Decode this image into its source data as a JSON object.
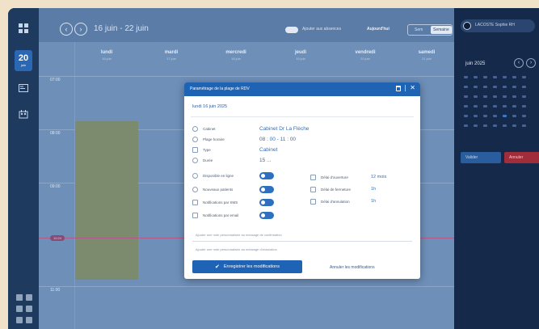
{
  "calendar": {
    "range": "16 juin - 22 juin",
    "toggle_label": "Ajouter aux absences",
    "today_label": "Aujourd'hui",
    "view_week": "Sem",
    "view_active": "Semaine",
    "days": [
      {
        "name": "lundi",
        "date": "16 juin"
      },
      {
        "name": "mardi",
        "date": "17 juin"
      },
      {
        "name": "mercredi",
        "date": "18 juin"
      },
      {
        "name": "jeudi",
        "date": "19 juin"
      },
      {
        "name": "vendredi",
        "date": "20 juin"
      },
      {
        "name": "samedi",
        "date": "21 juin"
      }
    ],
    "times": [
      "07:00",
      "08:00",
      "09:00",
      "11:00"
    ],
    "now": "10:24"
  },
  "rail": {
    "today_num": "20",
    "today_sub": "juin"
  },
  "right_panel": {
    "user_name": "LACOSTE Sophie RH",
    "month_title": "juin 2025",
    "validate_label": "Valider",
    "delete_label": "Annuler"
  },
  "modal": {
    "title": "Paramétrage de la plage de RDV",
    "date": "lundi 16 juin 2025",
    "rows": [
      {
        "label": "Cabinet",
        "value": "Cabinet Dr La Flèche"
      },
      {
        "label": "Plage horaire",
        "value": "08 : 00  -  11 : 00"
      },
      {
        "label": "Type",
        "value": "Cabinet"
      },
      {
        "label": "Durée",
        "value": "15 ..."
      }
    ],
    "toggles": [
      {
        "label": "Disponible en ligne"
      },
      {
        "label": "Nouveaux patients"
      },
      {
        "label": "Notifications par SMS"
      },
      {
        "label": "Notifications par email"
      }
    ],
    "delays": [
      {
        "label": "Délai d'ouverture",
        "value": "12 mois"
      },
      {
        "label": "Délai de fermeture",
        "value": "1h"
      },
      {
        "label": "Délai d'annulation",
        "value": "1h"
      }
    ],
    "note_confirm": "Ajouter une note personnalisée au message de confirmation",
    "note_cancel": "Ajouter une note personnalisée au message d'annulation",
    "save_label": "Enregistrer les modifications",
    "cancel_label": "Annuler les modifications"
  },
  "colors": {
    "accent": "#1f63b4",
    "background": "#efe2c8"
  }
}
